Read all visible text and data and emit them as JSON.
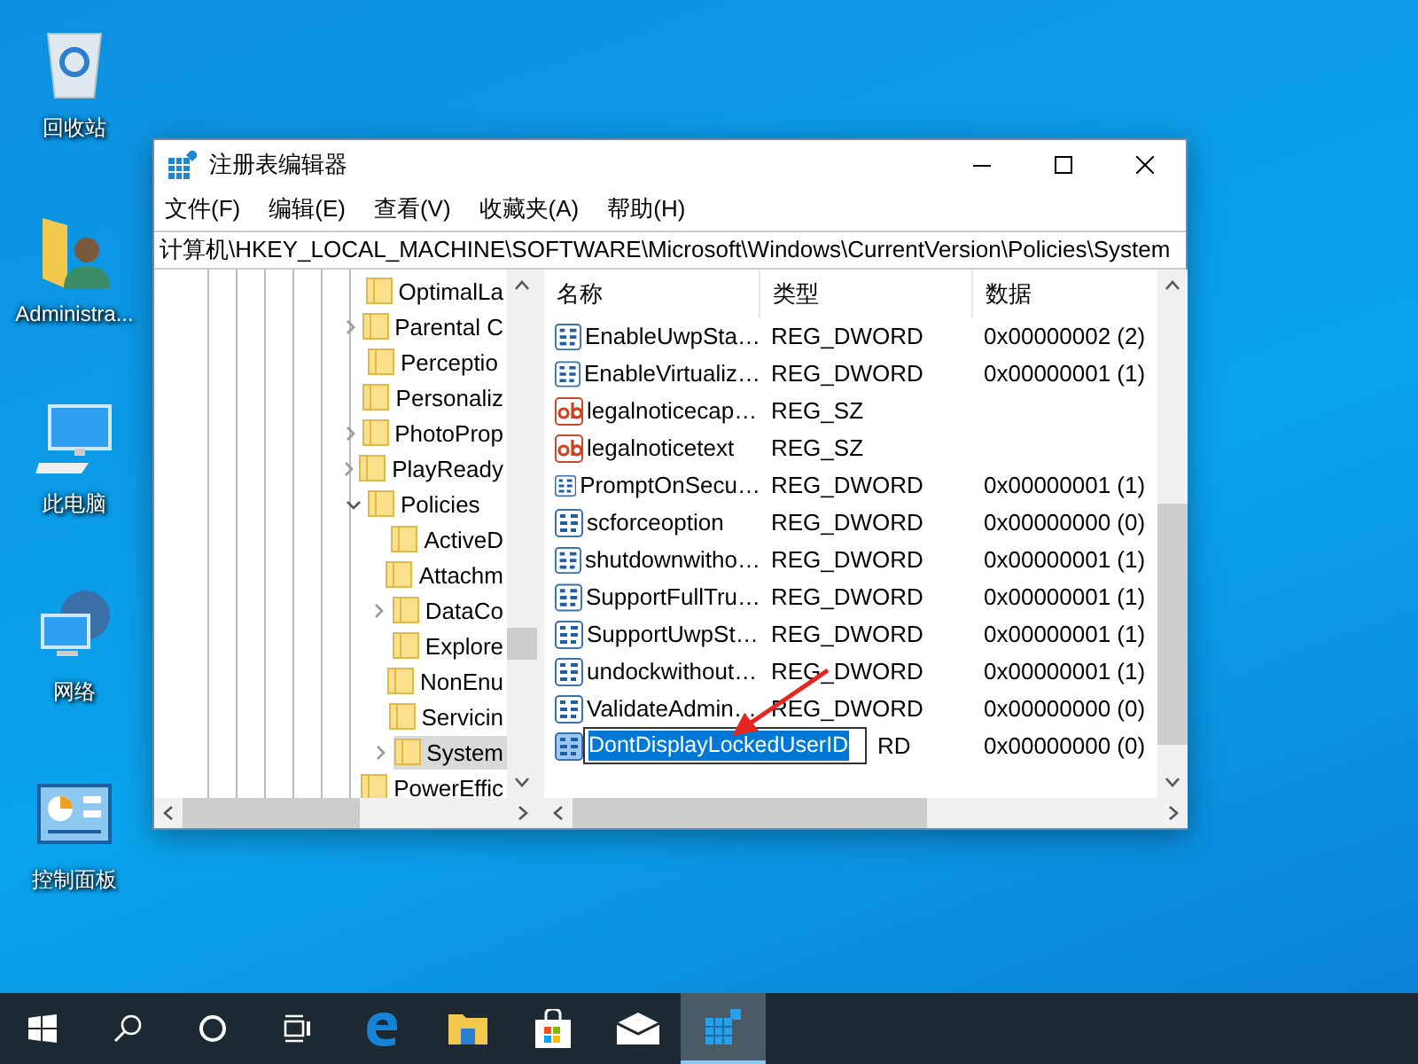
{
  "desktop_icons": [
    {
      "kind": "recycle-bin",
      "label": "回收站"
    },
    {
      "kind": "user-folder",
      "label": "Administra..."
    },
    {
      "kind": "computer",
      "label": "此电脑"
    },
    {
      "kind": "network",
      "label": "网络"
    },
    {
      "kind": "control-panel",
      "label": "控制面板"
    }
  ],
  "window": {
    "title": "注册表编辑器",
    "menu": [
      "文件(F)",
      "编辑(E)",
      "查看(V)",
      "收藏夹(A)",
      "帮助(H)"
    ],
    "address": "计算机\\HKEY_LOCAL_MACHINE\\SOFTWARE\\Microsoft\\Windows\\CurrentVersion\\Policies\\System",
    "tree": [
      {
        "label": "OptimalLa",
        "selected": false
      },
      {
        "label": "Parental C",
        "expanded": false,
        "selected": false
      },
      {
        "label": "Perceptio",
        "selected": false
      },
      {
        "label": "Personaliz",
        "selected": false
      },
      {
        "label": "PhotoProp",
        "expanded": false,
        "selected": false
      },
      {
        "label": "PlayReady",
        "expanded": false,
        "selected": false
      },
      {
        "label": "Policies",
        "expanded": true,
        "selected": false,
        "children": [
          {
            "label": "ActiveD",
            "selected": false
          },
          {
            "label": "Attachm",
            "selected": false
          },
          {
            "label": "DataCo",
            "expanded": false,
            "selected": false
          },
          {
            "label": "Explore",
            "selected": false
          },
          {
            "label": "NonEnu",
            "selected": false
          },
          {
            "label": "Servicin",
            "selected": false
          },
          {
            "label": "System",
            "expanded": false,
            "selected": true
          }
        ]
      },
      {
        "label": "PowerEffic",
        "selected": false
      }
    ],
    "columns": [
      "名称",
      "类型",
      "数据"
    ],
    "values": [
      {
        "kind": "dword",
        "name": "EnableUwpSta…",
        "type": "REG_DWORD",
        "data": "0x00000002 (2)",
        "editing": false
      },
      {
        "kind": "dword",
        "name": "EnableVirtualiz…",
        "type": "REG_DWORD",
        "data": "0x00000001 (1)",
        "editing": false
      },
      {
        "kind": "string",
        "name": "legalnoticecap…",
        "type": "REG_SZ",
        "editing": false
      },
      {
        "kind": "string",
        "name": "legalnoticetext",
        "type": "REG_SZ",
        "editing": false
      },
      {
        "kind": "dword",
        "name": "PromptOnSecu…",
        "type": "REG_DWORD",
        "data": "0x00000001 (1)",
        "editing": false
      },
      {
        "kind": "dword",
        "name": "scforceoption",
        "type": "REG_DWORD",
        "data": "0x00000000 (0)",
        "editing": false
      },
      {
        "kind": "dword",
        "name": "shutdownwitho…",
        "type": "REG_DWORD",
        "data": "0x00000001 (1)",
        "editing": false
      },
      {
        "kind": "dword",
        "name": "SupportFullTru…",
        "type": "REG_DWORD",
        "data": "0x00000001 (1)",
        "editing": false
      },
      {
        "kind": "dword",
        "name": "SupportUwpSt…",
        "type": "REG_DWORD",
        "data": "0x00000001 (1)",
        "editing": false
      },
      {
        "kind": "dword",
        "name": "undockwithout…",
        "type": "REG_DWORD",
        "data": "0x00000001 (1)",
        "editing": false
      },
      {
        "kind": "dword",
        "name": "ValidateAdmin…",
        "type": "REG_DWORD",
        "data": "0x00000000 (0)",
        "editing": false
      },
      {
        "kind": "dword",
        "name": "DontDisplayLockedUserID",
        "type": "RD",
        "data": "0x00000000 (0)",
        "editing": true
      }
    ]
  },
  "taskbar": [
    {
      "kind": "start",
      "active": false
    },
    {
      "kind": "search",
      "active": false
    },
    {
      "kind": "cortana",
      "active": false
    },
    {
      "kind": "task-view",
      "active": false
    },
    {
      "kind": "browser",
      "active": false
    },
    {
      "kind": "explorer",
      "active": false
    },
    {
      "kind": "store",
      "active": false
    },
    {
      "kind": "mail",
      "active": false
    },
    {
      "kind": "regedit",
      "active": true
    }
  ]
}
